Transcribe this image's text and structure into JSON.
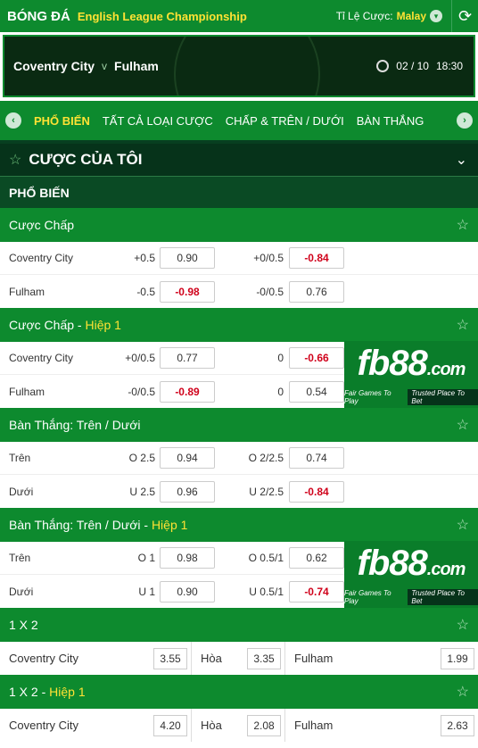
{
  "header": {
    "brand": "BÓNG ĐÁ",
    "league": "English League Championship",
    "odds_label": "Tỉ Lệ Cược:",
    "odds_value": "Malay"
  },
  "match": {
    "home": "Coventry City",
    "vs": "v",
    "away": "Fulham",
    "date": "02 / 10",
    "time": "18:30"
  },
  "tabs": [
    "PHỔ BIẾN",
    "TẤT CẢ LOẠI CƯỢC",
    "CHẤP & TRÊN / DƯỚI",
    "BÀN THẮNG"
  ],
  "mybets_title": "CƯỢC CỦA TÔI",
  "popular_title": "PHỔ BIẾN",
  "sections": {
    "s1": {
      "title": "Cược Chấp",
      "rows": [
        {
          "team": "Coventry City",
          "h1": "+0.5",
          "o1": "0.90",
          "h2": "+0/0.5",
          "o2": "-0.84"
        },
        {
          "team": "Fulham",
          "h1": "-0.5",
          "o1": "-0.98",
          "h2": "-0/0.5",
          "o2": "0.76"
        }
      ]
    },
    "s2": {
      "title": "Cược Chấp",
      "highlight": "Hiệp 1",
      "rows": [
        {
          "team": "Coventry City",
          "h1": "+0/0.5",
          "o1": "0.77",
          "h2": "0",
          "o2": "-0.66"
        },
        {
          "team": "Fulham",
          "h1": "-0/0.5",
          "o1": "-0.89",
          "h2": "0",
          "o2": "0.54"
        }
      ]
    },
    "s3": {
      "title": "Bàn Thắng: Trên / Dưới",
      "rows": [
        {
          "team": "Trên",
          "h1": "O 2.5",
          "o1": "0.94",
          "h2": "O 2/2.5",
          "o2": "0.74"
        },
        {
          "team": "Dưới",
          "h1": "U 2.5",
          "o1": "0.96",
          "h2": "U 2/2.5",
          "o2": "-0.84"
        }
      ]
    },
    "s4": {
      "title": "Bàn Thắng: Trên / Dưới",
      "highlight": "Hiệp 1",
      "rows": [
        {
          "team": "Trên",
          "h1": "O 1",
          "o1": "0.98",
          "h2": "O 0.5/1",
          "o2": "0.62"
        },
        {
          "team": "Dưới",
          "h1": "U 1",
          "o1": "0.90",
          "h2": "U 0.5/1",
          "o2": "-0.74"
        }
      ]
    },
    "s5": {
      "title": "1 X 2",
      "home": "Coventry City",
      "home_odd": "3.55",
      "draw": "Hòa",
      "draw_odd": "3.35",
      "away": "Fulham",
      "away_odd": "1.99"
    },
    "s6": {
      "title": "1 X 2",
      "highlight": "Hiệp 1",
      "home": "Coventry City",
      "home_odd": "4.20",
      "draw": "Hòa",
      "draw_odd": "2.08",
      "away": "Fulham",
      "away_odd": "2.63"
    }
  },
  "ad": {
    "logo": "fb88",
    "logo_suffix": ".com",
    "tag1": "Fair Games To Play",
    "tag2": "Trusted Place To Bet"
  },
  "colors": {
    "primary": "#0d8a2e",
    "dark": "#06331a",
    "accent": "#ffe234",
    "negative": "#d0021b"
  }
}
